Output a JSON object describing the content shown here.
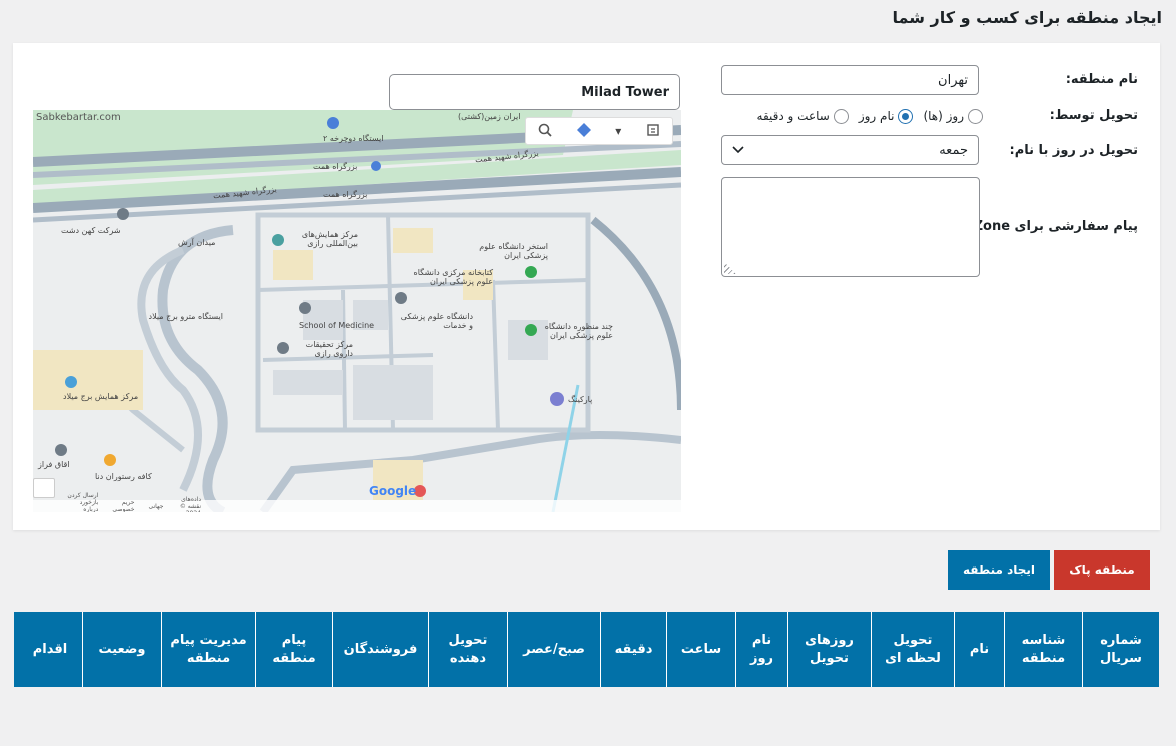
{
  "page": {
    "title": "ایجاد منطقه برای کسب و کار شما"
  },
  "form": {
    "zone_name_label": "نام منطقه:",
    "zone_name_value": "تهران",
    "delivery_by_label": "تحویل توسط:",
    "delivery_options": [
      {
        "label": "روز (ها)",
        "checked": false
      },
      {
        "label": "نام روز",
        "checked": true
      },
      {
        "label": "ساعت و دقیقه",
        "checked": false
      }
    ],
    "delivery_day_label": "تحویل در روز با نام:",
    "delivery_day_value": "جمعه",
    "custom_message_label": "پیام سفارشی برای Zone:",
    "custom_message_value": ""
  },
  "map": {
    "search_value": "Milad Tower",
    "watermark": "Sabkebartar.com",
    "labels": {
      "station": "ایستگاه دوچرخه ۲",
      "highway1": "بزرگراه شهید همت",
      "highway2": "بزرگراه شهید همت",
      "highway3": "بزرگراه همت",
      "highway4": "بزرگراه همت",
      "company": "شرکت کهن دشت",
      "arash": "میدان آرش",
      "conference": "مرکز همایش‌های بین‌المللی رازی",
      "pool": "استخر دانشگاه علوم پزشکی ایران",
      "library": "کتابخانه مرکزی دانشگاه علوم پزشکی ایران",
      "school": "School of Medicine",
      "university": "دانشگاه علوم پزشکی و خدمات",
      "dental": "چند منظوره دانشگاه علوم پزشکی ایران",
      "research": "مرکز تحقیقات داروی رازی",
      "metro": "ایستگاه مترو برج میلاد",
      "milad": "مرکز همایش برج میلاد",
      "parking": "پارکینگ",
      "oqaf": "اقاق فراز",
      "cafe": "کافه رستوران دنا",
      "zamin": "ایران زمین(کشتی)",
      "google": "Google"
    },
    "footer": [
      "داده‌های نقشه © 2024",
      "جهانی",
      "حریم خصوصی",
      "ارسال کردن بازخورد درباره محصول"
    ]
  },
  "actions": {
    "clear_zone": "منطقه پاک",
    "create_zone": "ایجاد منطقه"
  },
  "table": {
    "headers": [
      "شماره سریال",
      "شناسه منطقه",
      "نام",
      "تحویل لحظه ای",
      "روزهای تحویل",
      "نام روز",
      "ساعت",
      "دقیقه",
      "صبح/عصر",
      "تحویل دهنده",
      "فروشندگان",
      "پیام منطقه",
      "مدیریت پیام منطقه",
      "وضعیت",
      "اقدام"
    ]
  },
  "colors": {
    "primary": "#0271a8",
    "danger": "#c9372c",
    "bg": "#f0f0f1"
  }
}
